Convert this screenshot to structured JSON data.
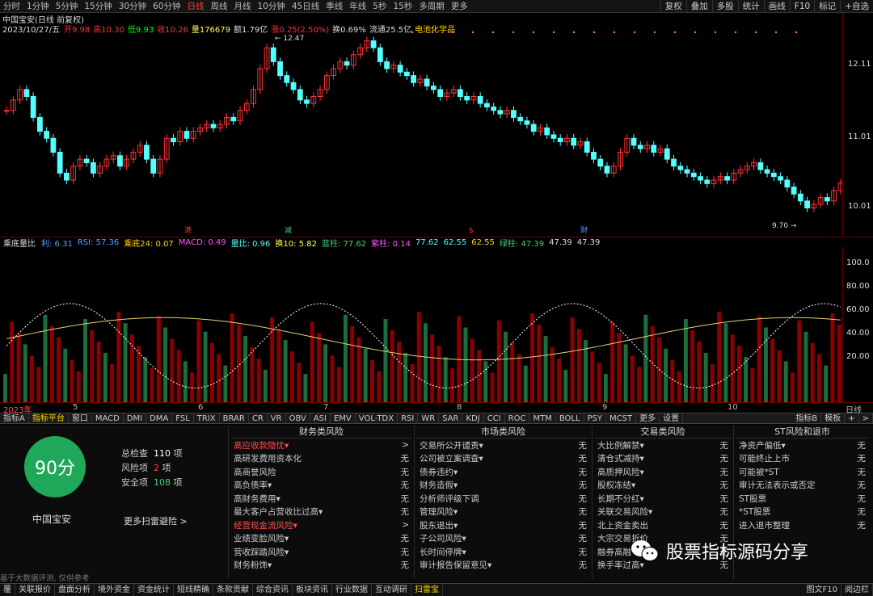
{
  "topbar": {
    "periods": [
      "分时",
      "1分钟",
      "5分钟",
      "15分钟",
      "30分钟",
      "60分钟",
      "日线",
      "周线",
      "月线",
      "10分钟",
      "45日线",
      "季线",
      "年线",
      "5秒",
      "15秒",
      "多周期",
      "更多"
    ],
    "active_period": "日线",
    "right": [
      "复权",
      "叠加",
      "多股",
      "统计",
      "画线",
      "F10",
      "标记",
      "+自选"
    ]
  },
  "stock": {
    "name": "中国宝安(日线 前复权)",
    "date": "2023/10/27/五",
    "open": "开9.98",
    "high": "高10.30",
    "low": "低9.93",
    "close": "收10.26",
    "volume": "量176679",
    "amount": "额1.79亿",
    "change": "涨0.25(2.50%)",
    "turnover": "换0.69%",
    "float": "流通25.5亿",
    "tag": "电池化学品",
    "high_mark": "12.47",
    "low_mark": "9.70"
  },
  "price_scale": [
    "12.11",
    "11.01",
    "10.01"
  ],
  "event_markers": [
    "港",
    "减",
    "$",
    "财"
  ],
  "indicator": {
    "name": "乘底量比",
    "items": [
      "利: 6.31",
      "RSI: 57.36",
      "乘底24: 0.07",
      "MACD: 0.49",
      "量比: 0.96",
      "换10: 5.82",
      "蓝柱: 77.62",
      "紫柱: 0.14",
      "77.62",
      "62.55",
      "62.55",
      "绿柱: 47.39",
      "47.39",
      "47.39"
    ]
  },
  "ind_scale": [
    "100.0",
    "80.00",
    "60.00",
    "40.00",
    "20.00"
  ],
  "date_axis": [
    "2023年",
    "5",
    "6",
    "7",
    "8",
    "9",
    "10",
    "日线"
  ],
  "tabs": [
    "指标A",
    "指标平台",
    "窗口",
    "MACD",
    "DMI",
    "DMA",
    "FSL",
    "TRIX",
    "BRAR",
    "CR",
    "VR",
    "OBV",
    "ASI",
    "EMV",
    "VOL-TDX",
    "RSI",
    "WR",
    "SAR",
    "KDJ",
    "CCI",
    "ROC",
    "MTM",
    "BOLL",
    "PSY",
    "MCST",
    "更多",
    "设置"
  ],
  "tabs_right": [
    "指标B",
    "模板",
    "+",
    ">"
  ],
  "scan": {
    "score": "90分",
    "stock_name": "中国宝安",
    "total_label": "总检查",
    "total_value": "110",
    "total_unit": "项",
    "risk_label": "风险项",
    "risk_value": "2",
    "risk_unit": "项",
    "safe_label": "安全项",
    "safe_value": "108",
    "safe_unit": "项",
    "more_link": "更多扫雷避险 >",
    "footnote": "基于大数据评测, 仅供参考"
  },
  "columns": [
    {
      "title": "财务类风险",
      "rows": [
        {
          "name": "高应收款隐忧▾",
          "value": ">",
          "red": true
        },
        {
          "name": "高研发费用资本化",
          "value": "无"
        },
        {
          "name": "高商誉风险",
          "value": "无"
        },
        {
          "name": "高负债率▾",
          "value": "无"
        },
        {
          "name": "高财务费用▾",
          "value": "无"
        },
        {
          "name": "最大客户占营收比过高▾",
          "value": "无"
        },
        {
          "name": "经营现金流风险▾",
          "value": ">",
          "red": true
        },
        {
          "name": "业绩变脸风险▾",
          "value": "无"
        },
        {
          "name": "营收踩踏风险▾",
          "value": "无"
        },
        {
          "name": "财务粉饰▾",
          "value": "无"
        }
      ]
    },
    {
      "title": "市场类风险",
      "rows": [
        {
          "name": "交易所公开谴责▾",
          "value": "无"
        },
        {
          "name": "公司被立案调查▾",
          "value": "无"
        },
        {
          "name": "债券违约▾",
          "value": "无"
        },
        {
          "name": "财务造假▾",
          "value": "无"
        },
        {
          "name": "分析师评级下调",
          "value": "无"
        },
        {
          "name": "管理风险▾",
          "value": "无"
        },
        {
          "name": "股东退出▾",
          "value": "无"
        },
        {
          "name": "子公司风险▾",
          "value": "无"
        },
        {
          "name": "长时间停牌▾",
          "value": "无"
        },
        {
          "name": "审计报告保留意见▾",
          "value": "无"
        }
      ]
    },
    {
      "title": "交易类风险",
      "rows": [
        {
          "name": "大比例解禁▾",
          "value": "无"
        },
        {
          "name": "清仓式减持▾",
          "value": "无"
        },
        {
          "name": "高质押风险▾",
          "value": "无"
        },
        {
          "name": "股权冻结▾",
          "value": "无"
        },
        {
          "name": "长期不分红▾",
          "value": "无"
        },
        {
          "name": "关联交易风险▾",
          "value": "无"
        },
        {
          "name": "北上资金卖出",
          "value": "无"
        },
        {
          "name": "大宗交易折价",
          "value": "无"
        },
        {
          "name": "融券高融",
          "value": "无"
        },
        {
          "name": "换手率过高▾",
          "value": "无"
        }
      ]
    },
    {
      "title": "ST风险和退市",
      "rows": [
        {
          "name": "净资产偏低▾",
          "value": "无"
        },
        {
          "name": "可能终止上市",
          "value": "无"
        },
        {
          "name": "可能被*ST",
          "value": "无"
        },
        {
          "name": "审计无法表示或否定",
          "value": "无"
        },
        {
          "name": "ST股票",
          "value": "无"
        },
        {
          "name": "*ST股票",
          "value": "无"
        },
        {
          "name": "进入退市整理",
          "value": "无"
        }
      ]
    }
  ],
  "watermark": "股票指标源码分享",
  "bottombar": [
    "关联报价",
    "盘面分析",
    "境外资金",
    "资金统计",
    "短线精确",
    "条款贡献",
    "综合资讯",
    "板块资讯",
    "行业数据",
    "互动调研",
    "扫雷宝"
  ],
  "bottom_active": "扫雷宝",
  "bottom_left": "覆",
  "bottom_right": [
    "图文F10",
    "阅边栏"
  ],
  "colors": {
    "up": "#ff3333",
    "down": "#54ffff",
    "accent": "#ffd700",
    "score_bg": "#1fa85a"
  }
}
